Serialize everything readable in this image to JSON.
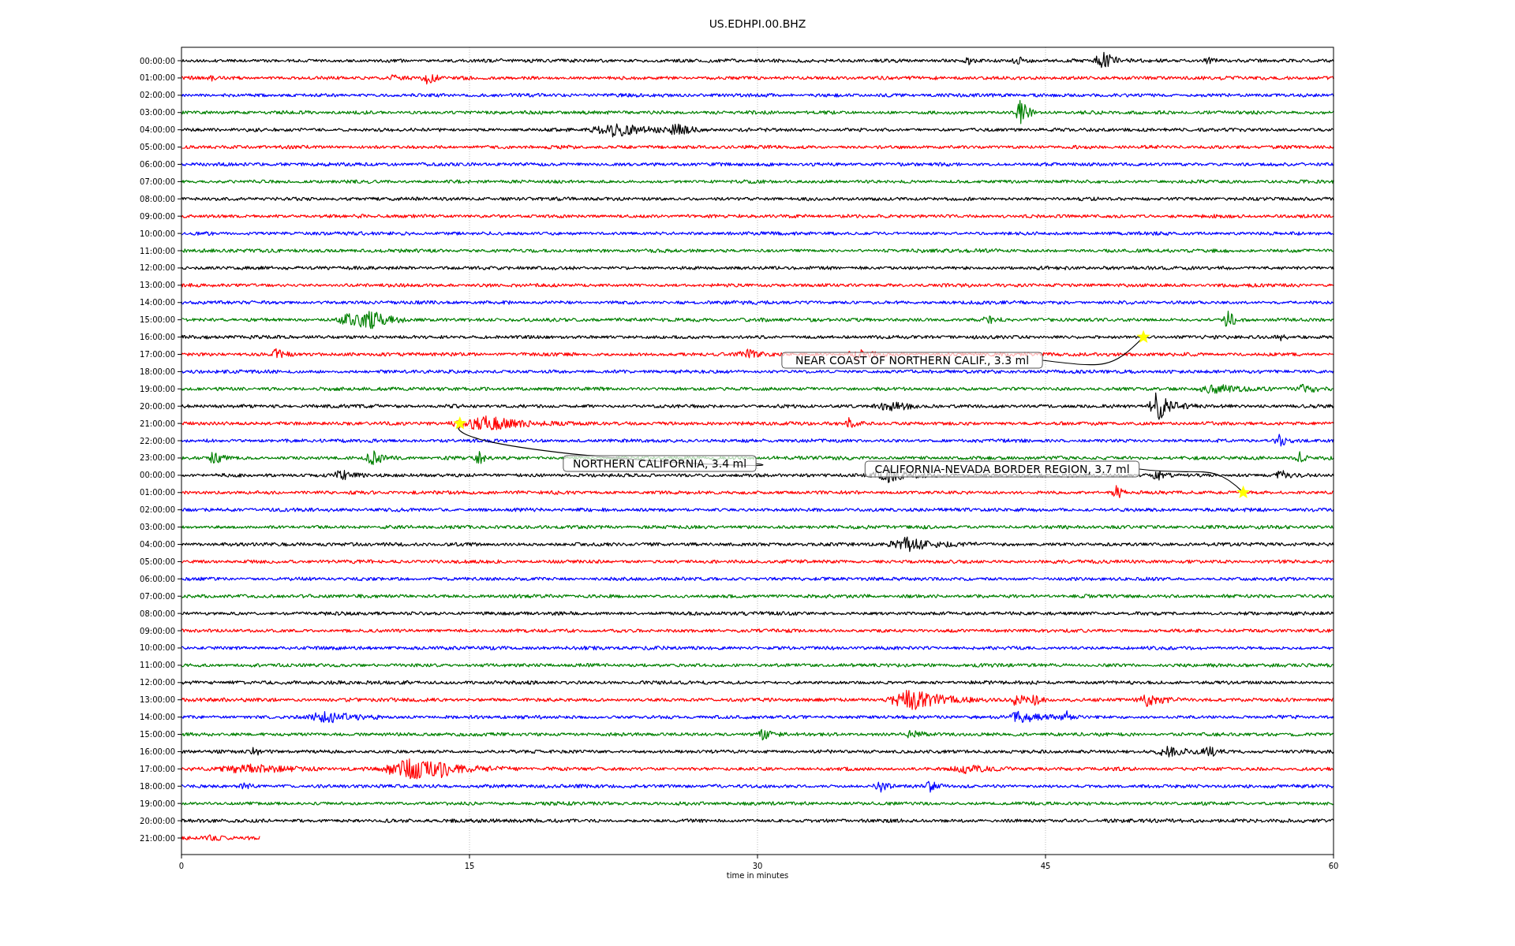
{
  "title": "US.EDHPI.00.BHZ",
  "traces": [
    {
      "label": "00:00:00",
      "color": "#000000",
      "level": 1
    },
    {
      "label": "01:00:00",
      "color": "#ff0000",
      "level": 1
    },
    {
      "label": "02:00:00",
      "color": "#0000ff",
      "level": 1
    },
    {
      "label": "03:00:00",
      "color": "#008000",
      "level": 1
    },
    {
      "label": "04:00:00",
      "color": "#000000",
      "level": 1
    },
    {
      "label": "05:00:00",
      "color": "#ff0000",
      "level": 1
    },
    {
      "label": "06:00:00",
      "color": "#0000ff",
      "level": 1
    },
    {
      "label": "07:00:00",
      "color": "#008000",
      "level": 1
    },
    {
      "label": "08:00:00",
      "color": "#000000",
      "level": 1
    },
    {
      "label": "09:00:00",
      "color": "#ff0000",
      "level": 1
    },
    {
      "label": "10:00:00",
      "color": "#0000ff",
      "level": 1
    },
    {
      "label": "11:00:00",
      "color": "#008000",
      "level": 1
    },
    {
      "label": "12:00:00",
      "color": "#000000",
      "level": 1
    },
    {
      "label": "13:00:00",
      "color": "#ff0000",
      "level": 1
    },
    {
      "label": "14:00:00",
      "color": "#0000ff",
      "level": 1
    },
    {
      "label": "15:00:00",
      "color": "#008000",
      "level": 1
    },
    {
      "label": "16:00:00",
      "color": "#000000",
      "level": 1
    },
    {
      "label": "17:00:00",
      "color": "#ff0000",
      "level": 1
    },
    {
      "label": "18:00:00",
      "color": "#0000ff",
      "level": 1
    },
    {
      "label": "19:00:00",
      "color": "#008000",
      "level": 1
    },
    {
      "label": "20:00:00",
      "color": "#000000",
      "level": 1
    },
    {
      "label": "21:00:00",
      "color": "#ff0000",
      "level": 1
    },
    {
      "label": "22:00:00",
      "color": "#0000ff",
      "level": 1
    },
    {
      "label": "23:00:00",
      "color": "#008000",
      "level": 1
    },
    {
      "label": "00:00:00",
      "color": "#000000",
      "level": 1
    },
    {
      "label": "01:00:00",
      "color": "#ff0000",
      "level": 1
    },
    {
      "label": "02:00:00",
      "color": "#0000ff",
      "level": 1
    },
    {
      "label": "03:00:00",
      "color": "#008000",
      "level": 1
    },
    {
      "label": "04:00:00",
      "color": "#000000",
      "level": 1
    },
    {
      "label": "05:00:00",
      "color": "#ff0000",
      "level": 1
    },
    {
      "label": "06:00:00",
      "color": "#0000ff",
      "level": 1
    },
    {
      "label": "07:00:00",
      "color": "#008000",
      "level": 1
    },
    {
      "label": "08:00:00",
      "color": "#000000",
      "level": 1
    },
    {
      "label": "09:00:00",
      "color": "#ff0000",
      "level": 1
    },
    {
      "label": "10:00:00",
      "color": "#0000ff",
      "level": 1
    },
    {
      "label": "11:00:00",
      "color": "#008000",
      "level": 1
    },
    {
      "label": "12:00:00",
      "color": "#000000",
      "level": 1
    },
    {
      "label": "13:00:00",
      "color": "#ff0000",
      "level": 1
    },
    {
      "label": "14:00:00",
      "color": "#0000ff",
      "level": 1
    },
    {
      "label": "15:00:00",
      "color": "#008000",
      "level": 1
    },
    {
      "label": "16:00:00",
      "color": "#000000",
      "level": 1
    },
    {
      "label": "17:00:00",
      "color": "#ff0000",
      "level": 1
    },
    {
      "label": "18:00:00",
      "color": "#0000ff",
      "level": 1
    },
    {
      "label": "19:00:00",
      "color": "#008000",
      "level": 1
    },
    {
      "label": "20:00:00",
      "color": "#000000",
      "level": 1
    },
    {
      "label": "21:00:00",
      "color": "#ff0000",
      "level": 0.068
    }
  ],
  "annotations": [
    {
      "text": "NEAR COAST OF NORTHERN CALIF., 3.3 ml"
    },
    {
      "text": "NORTHERN CALIFORNIA, 3.4 ml"
    },
    {
      "text": "CALIFORNIA-NEVADA BORDER REGION, 3.7 ml"
    }
  ],
  "x_ticks": [
    "0",
    "15",
    "30",
    "45",
    "60"
  ],
  "xlabel": "time in minutes"
}
